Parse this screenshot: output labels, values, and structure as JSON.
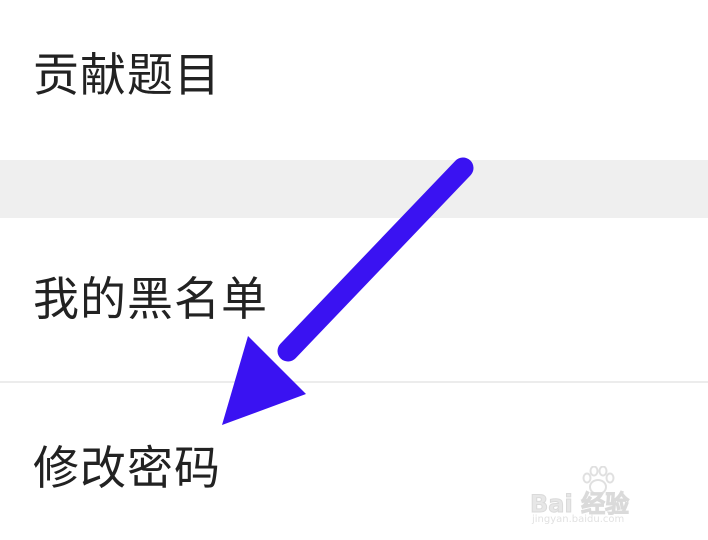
{
  "menu": {
    "items": [
      {
        "label": "贡献题目"
      },
      {
        "label": "我的黑名单"
      },
      {
        "label": "修改密码"
      }
    ]
  },
  "annotation": {
    "arrow_color": "#3a12f2",
    "icon": "arrow-down-left-icon"
  },
  "watermark": {
    "brand": "Bai 经验",
    "url": "jingyan.baidu.com"
  },
  "colors": {
    "background": "#ffffff",
    "section_gap": "#efefef",
    "divider": "#ececec",
    "text": "#222222"
  }
}
